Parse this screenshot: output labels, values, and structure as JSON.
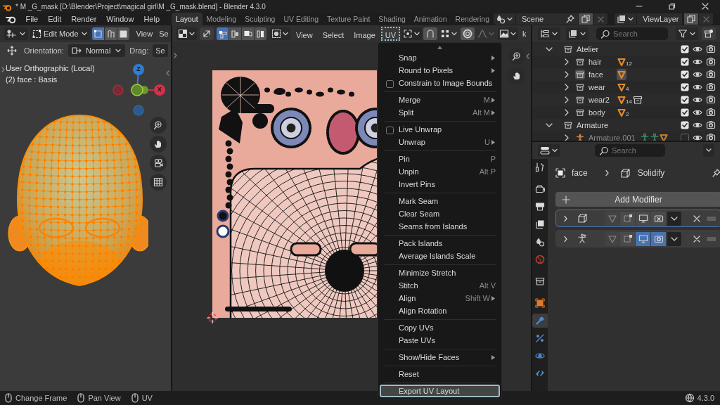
{
  "window": {
    "title": "* M _G_mask [D:\\Blender\\Project\\magical girl\\M _G_mask.blend] - Blender 4.3.0"
  },
  "menu_bar": [
    "File",
    "Edit",
    "Render",
    "Window",
    "Help"
  ],
  "workspace_tabs": [
    {
      "label": "Layout",
      "selected": true
    },
    {
      "label": "Modeling",
      "selected": false
    },
    {
      "label": "Sculpting",
      "selected": false
    },
    {
      "label": "UV Editing",
      "selected": false
    },
    {
      "label": "Texture Paint",
      "selected": false
    },
    {
      "label": "Shading",
      "selected": false
    },
    {
      "label": "Animation",
      "selected": false
    },
    {
      "label": "Rendering",
      "selected": false
    }
  ],
  "scene_selector": {
    "value": "Scene"
  },
  "view_layer_selector": {
    "value": "ViewLayer"
  },
  "viewport": {
    "mode": "Edit Mode",
    "select_modes": [
      {
        "selected": true
      },
      {
        "selected": false
      },
      {
        "selected": false
      }
    ],
    "menus": [
      "View",
      "Se"
    ],
    "orientation_label": "Orientation:",
    "orientation": "Normal",
    "drag_label": "Drag:",
    "drag_value": "Se",
    "view_name": "User Orthographic (Local)",
    "object_info": "(2) face : Basis",
    "gizmo_labels": [
      "Z",
      "X"
    ]
  },
  "uv_editor": {
    "select_modes": [
      {
        "selected": true
      },
      {
        "selected": false
      },
      {
        "selected": false
      },
      {
        "selected": false
      }
    ],
    "menus": [
      {
        "label": "View",
        "selected": false
      },
      {
        "label": "Select",
        "selected": false
      },
      {
        "label": "Image",
        "selected": false
      },
      {
        "label": "UV",
        "selected": true
      }
    ],
    "cut_label": "k"
  },
  "uv_menu": {
    "groups": [
      [
        {
          "kind": "command",
          "label": "Snap",
          "submenu": true,
          "selected": false
        },
        {
          "kind": "command",
          "label": "Round to Pixels",
          "submenu": true,
          "selected": false
        },
        {
          "kind": "checkbox",
          "label": "Constrain to Image Bounds",
          "checked": false,
          "submenu": false,
          "selected": false
        }
      ],
      [
        {
          "kind": "command",
          "label": "Merge",
          "shortcut": "M",
          "submenu": true,
          "selected": false
        },
        {
          "kind": "command",
          "label": "Split",
          "shortcut": "Alt M",
          "submenu": true,
          "selected": false
        }
      ],
      [
        {
          "kind": "checkbox",
          "label": "Live Unwrap",
          "checked": false,
          "submenu": false,
          "selected": false
        },
        {
          "kind": "command",
          "label": "Unwrap",
          "shortcut": "U",
          "submenu": true,
          "selected": false
        }
      ],
      [
        {
          "kind": "command",
          "label": "Pin",
          "shortcut": "P",
          "submenu": false,
          "selected": false
        },
        {
          "kind": "command",
          "label": "Unpin",
          "shortcut": "Alt P",
          "submenu": false,
          "selected": false
        },
        {
          "kind": "command",
          "label": "Invert Pins",
          "submenu": false,
          "selected": false
        }
      ],
      [
        {
          "kind": "command",
          "label": "Mark Seam",
          "submenu": false,
          "selected": false
        },
        {
          "kind": "command",
          "label": "Clear Seam",
          "submenu": false,
          "selected": false
        },
        {
          "kind": "command",
          "label": "Seams from Islands",
          "submenu": false,
          "selected": false
        }
      ],
      [
        {
          "kind": "command",
          "label": "Pack Islands",
          "submenu": false,
          "selected": false
        },
        {
          "kind": "command",
          "label": "Average Islands Scale",
          "submenu": false,
          "selected": false
        }
      ],
      [
        {
          "kind": "command",
          "label": "Minimize Stretch",
          "submenu": false,
          "selected": false
        },
        {
          "kind": "command",
          "label": "Stitch",
          "shortcut": "Alt V",
          "submenu": false,
          "selected": false
        },
        {
          "kind": "command",
          "label": "Align",
          "shortcut": "Shift W",
          "submenu": true,
          "selected": false
        },
        {
          "kind": "command",
          "label": "Align Rotation",
          "submenu": false,
          "selected": false
        }
      ],
      [
        {
          "kind": "command",
          "label": "Copy UVs",
          "submenu": false,
          "selected": false
        },
        {
          "kind": "command",
          "label": "Paste UVs",
          "submenu": false,
          "selected": false
        }
      ],
      [
        {
          "kind": "command",
          "label": "Show/Hide Faces",
          "submenu": true,
          "selected": false
        }
      ],
      [
        {
          "kind": "command",
          "label": "Reset",
          "submenu": false,
          "selected": false
        }
      ],
      [
        {
          "kind": "command",
          "label": "Export UV Layout",
          "submenu": false,
          "selected": true
        }
      ]
    ]
  },
  "outliner": {
    "search": {
      "placeholder": "Search"
    },
    "tree": [
      {
        "kind": "collection",
        "name": "Atelier",
        "expanded": true,
        "checked": true,
        "active": false,
        "mesh_badge": false,
        "nested_collection": false,
        "children": [
          {
            "kind": "collection",
            "name": "hair",
            "expanded": false,
            "checked": true,
            "active": false,
            "mesh_badge": true,
            "count": "12",
            "nested_collection": false
          },
          {
            "kind": "collection",
            "name": "face",
            "expanded": false,
            "checked": true,
            "active": true,
            "mesh_badge": true,
            "nested_collection": false
          },
          {
            "kind": "collection",
            "name": "wear",
            "expanded": false,
            "checked": true,
            "active": false,
            "mesh_badge": true,
            "count": "4",
            "nested_collection": false
          },
          {
            "kind": "collection",
            "name": "wear2",
            "expanded": false,
            "checked": true,
            "active": false,
            "mesh_badge": true,
            "count": "14",
            "nested_collection": true
          },
          {
            "kind": "collection",
            "name": "body",
            "expanded": false,
            "checked": true,
            "active": false,
            "mesh_badge": true,
            "count": "2",
            "nested_collection": false
          }
        ]
      },
      {
        "kind": "collection",
        "name": "Armature",
        "expanded": true,
        "checked": true,
        "active": false,
        "mesh_badge": false,
        "nested_collection": false,
        "children": [
          {
            "kind": "armature",
            "name": "Armature.001",
            "expanded": false,
            "checked": false,
            "active": false,
            "mesh_badge": false,
            "nested_collection": false
          }
        ]
      }
    ]
  },
  "properties": {
    "search": {
      "placeholder": "Search"
    },
    "tabs": [
      {
        "selected": false
      },
      {
        "selected": false
      },
      {
        "selected": false
      },
      {
        "selected": false
      },
      {
        "selected": false
      },
      {
        "selected": false
      },
      {
        "selected": false
      },
      {
        "selected": false
      },
      {
        "selected": true
      },
      {
        "selected": false
      },
      {
        "selected": false
      },
      {
        "selected": false
      }
    ],
    "object": "face",
    "modifier": "Solidify",
    "add_button": "Add Modifier",
    "modifiers": [
      {
        "kind": "solidify",
        "active": true,
        "show_viewport": false,
        "show_render": false
      },
      {
        "kind": "armature",
        "active": false,
        "show_viewport": true,
        "show_render": true
      }
    ]
  },
  "status_bar": {
    "hints": [
      "Change Frame",
      "Pan View",
      "UV"
    ],
    "version": "4.3.0"
  }
}
